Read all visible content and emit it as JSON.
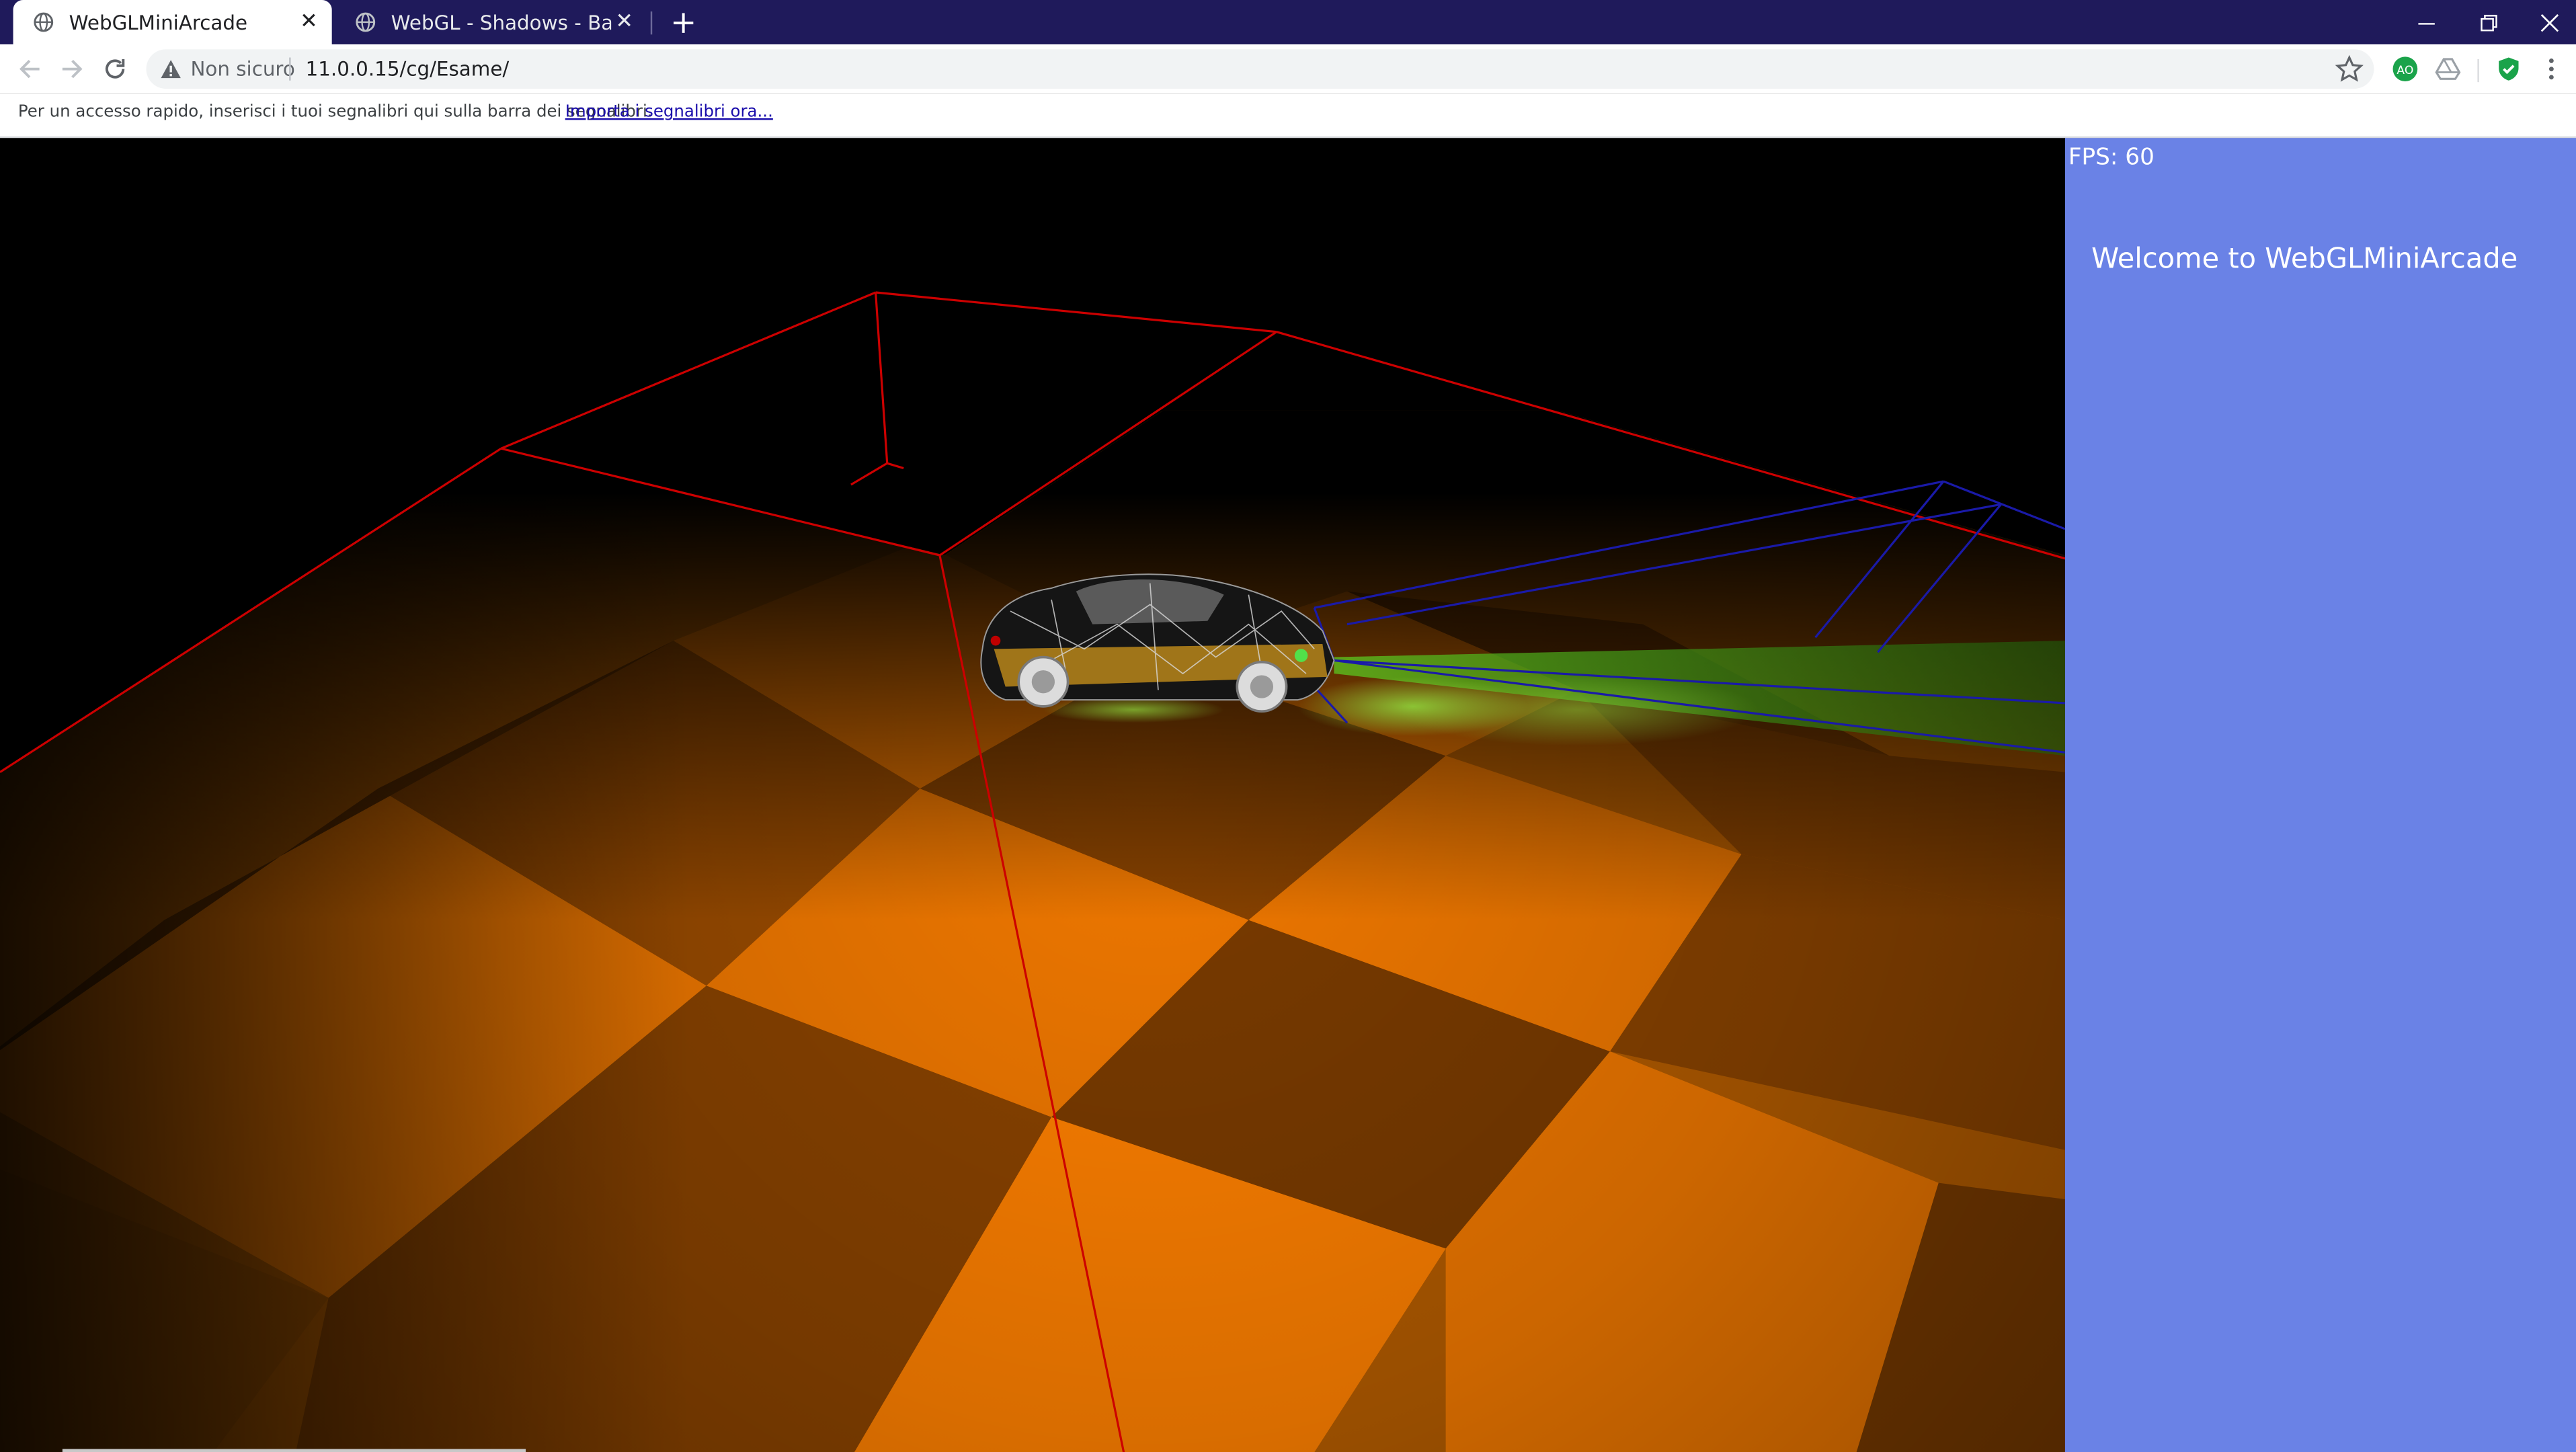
{
  "browser": {
    "tabs": [
      {
        "title": "WebGLMiniArcade",
        "active": true
      },
      {
        "title": "WebGL - Shadows - Basic w/spot",
        "active": false
      }
    ],
    "security_text": "Non sicuro",
    "url": "11.0.0.15/cg/Esame/",
    "extension_badge": "AO",
    "bookmarks_message": "Per un accesso rapido, inserisci i tuoi segnalibri qui sulla barra dei segnalibri.",
    "bookmarks_import_link": "Importa i segnalibri ora...",
    "colors": {
      "tabstrip": "#1f1a5b",
      "toolbar": "#ffffff"
    }
  },
  "scene": {
    "description_colors": {
      "background": "#000000",
      "floor_light": "#f07800",
      "floor_dark": "#8a4300",
      "bounding_box_car": "#cc0000",
      "bounding_box_light": "#1a1aa8",
      "headlight_glow": "#3fa81a"
    }
  },
  "side_panel": {
    "fps": "FPS: 60",
    "welcome": "Welcome to WebGLMiniArcade",
    "background": "#6a82e6"
  }
}
